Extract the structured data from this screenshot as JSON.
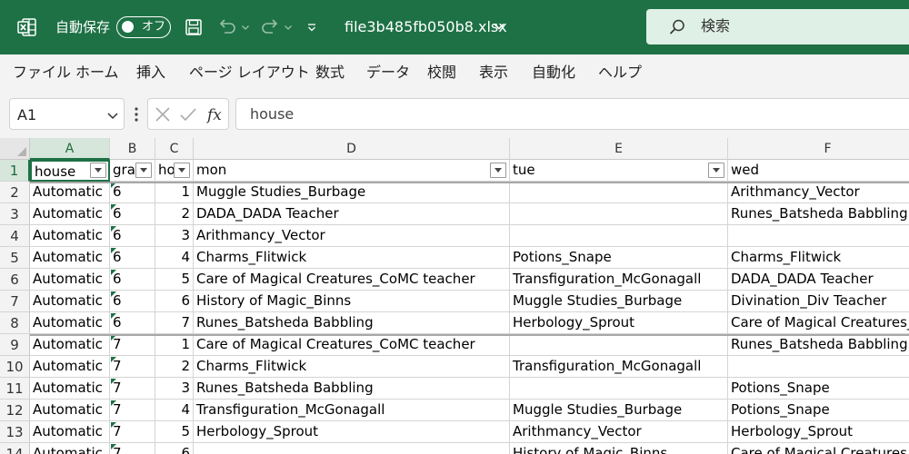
{
  "titlebar": {
    "autosave_label": "自動保存",
    "toggle_label": "オフ",
    "filename": "file3b485fb050b8.xlsx",
    "search_label": "検索"
  },
  "menu": [
    "ファイル",
    "ホーム",
    "挿入",
    "ページ レイアウト",
    "数式",
    "データ",
    "校閲",
    "表示",
    "自動化",
    "ヘルプ"
  ],
  "formula_bar": {
    "name_box": "A1",
    "formula": "house"
  },
  "sheet": {
    "columns": [
      "A",
      "B",
      "C",
      "D",
      "E",
      "F"
    ],
    "row_numbers": [
      "1",
      "2",
      "3",
      "4",
      "5",
      "6",
      "7",
      "8",
      "9",
      "10",
      "11",
      "12",
      "13",
      "14"
    ],
    "header": {
      "a": "house",
      "b": "grade",
      "c": "hour",
      "d": "mon",
      "e": "tue",
      "f": "wed"
    },
    "rows": [
      {
        "a": "Automatic",
        "b": "6",
        "c": "1",
        "d": "Muggle Studies_Burbage",
        "e": "",
        "f": "Arithmancy_Vector"
      },
      {
        "a": "Automatic",
        "b": "6",
        "c": "2",
        "d": "DADA_DADA Teacher",
        "e": "",
        "f": "Runes_Batsheda Babbling"
      },
      {
        "a": "Automatic",
        "b": "6",
        "c": "3",
        "d": "Arithmancy_Vector",
        "e": "",
        "f": ""
      },
      {
        "a": "Automatic",
        "b": "6",
        "c": "4",
        "d": "Charms_Flitwick",
        "e": "Potions_Snape",
        "f": "Charms_Flitwick"
      },
      {
        "a": "Automatic",
        "b": "6",
        "c": "5",
        "d": "Care of Magical Creatures_CoMC teacher",
        "e": "Transfiguration_McGonagall",
        "f": "DADA_DADA Teacher"
      },
      {
        "a": "Automatic",
        "b": "6",
        "c": "6",
        "d": "History of Magic_Binns",
        "e": "Muggle Studies_Burbage",
        "f": "Divination_Div Teacher"
      },
      {
        "a": "Automatic",
        "b": "6",
        "c": "7",
        "d": "Runes_Batsheda Babbling",
        "e": "Herbology_Sprout",
        "f": "Care of Magical Creatures_"
      },
      {
        "a": "Automatic",
        "b": "7",
        "c": "1",
        "d": "Care of Magical Creatures_CoMC teacher",
        "e": "",
        "f": "Runes_Batsheda Babbling"
      },
      {
        "a": "Automatic",
        "b": "7",
        "c": "2",
        "d": "Charms_Flitwick",
        "e": "Transfiguration_McGonagall",
        "f": ""
      },
      {
        "a": "Automatic",
        "b": "7",
        "c": "3",
        "d": "Runes_Batsheda Babbling",
        "e": "",
        "f": "Potions_Snape"
      },
      {
        "a": "Automatic",
        "b": "7",
        "c": "4",
        "d": "Transfiguration_McGonagall",
        "e": "Muggle Studies_Burbage",
        "f": "Potions_Snape"
      },
      {
        "a": "Automatic",
        "b": "7",
        "c": "5",
        "d": "Herbology_Sprout",
        "e": "Arithmancy_Vector",
        "f": "Herbology_Sprout"
      },
      {
        "a": "Automatic",
        "b": "7",
        "c": "6",
        "d": "",
        "e": "History of Magic_Binns",
        "f": "Care of Magical Creatures_"
      }
    ]
  },
  "colors": {
    "brand_green": "#1e7145",
    "search_bg": "#dff0e6",
    "toolbar_bg": "#f3f3f3"
  }
}
